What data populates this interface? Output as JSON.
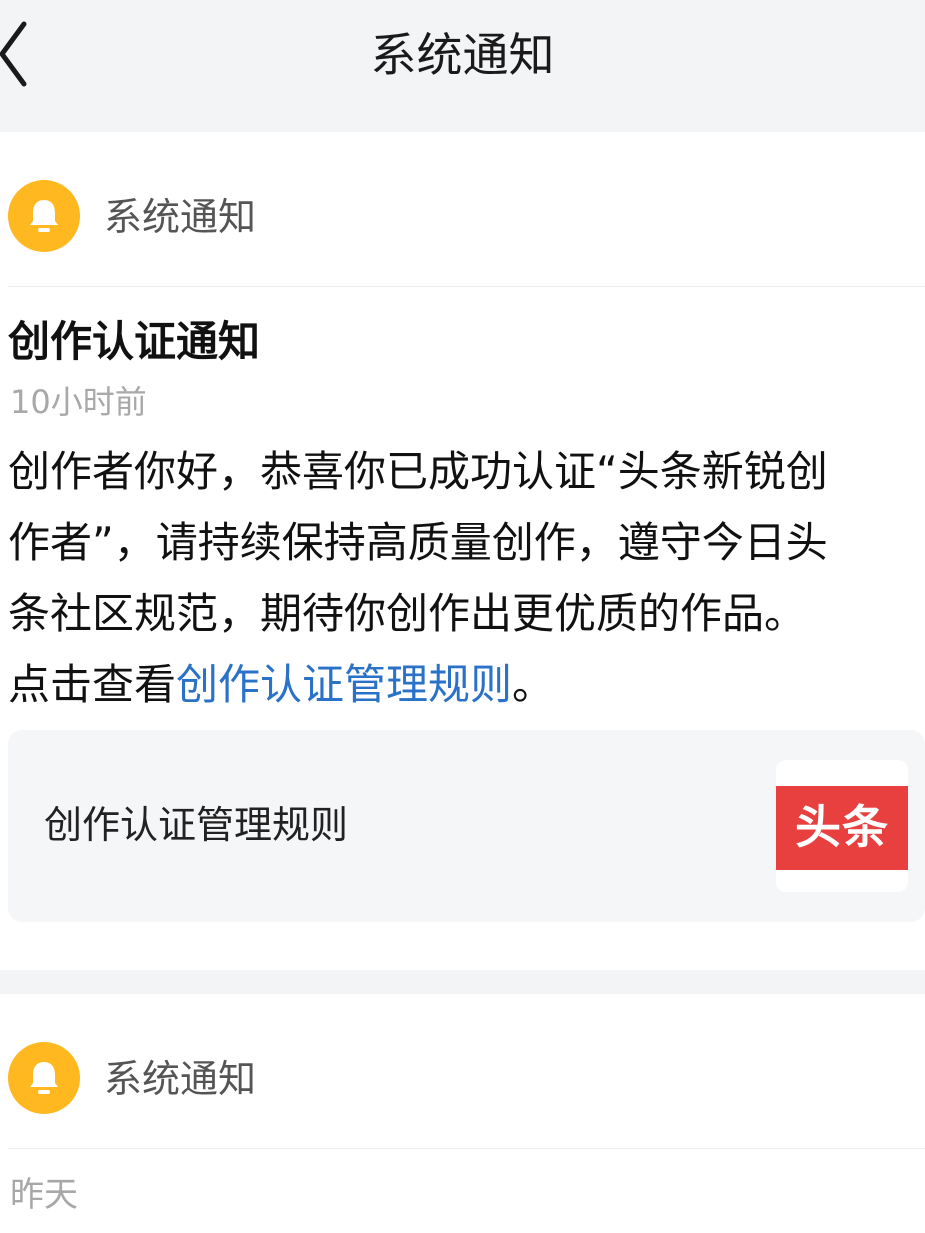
{
  "header": {
    "title": "系统通知"
  },
  "notice1": {
    "sender": "系统通知",
    "title": "创作认证通知",
    "time": "10小时前",
    "body": {
      "line1": "创作者你好，恭喜你已成功认证“头条新锐创",
      "line2": "作者”，请持续保持高质量创作，遵守今日头",
      "line3": "条社区规范，期待你创作出更优质的作品。",
      "line4_prefix": "点击查看",
      "link_text": "创作认证管理规则",
      "line4_suffix": "。"
    },
    "card": {
      "title": "创作认证管理规则",
      "logo_text": "头条"
    }
  },
  "notice2": {
    "sender": "系统通知",
    "time": "昨天"
  },
  "colors": {
    "bell": "#ffb81f",
    "link": "#2a72c7",
    "logo": "#e8403f",
    "topbar_bg": "#f3f4f6"
  },
  "icons": {
    "back": "chevron-left-icon",
    "bell": "bell-icon"
  }
}
